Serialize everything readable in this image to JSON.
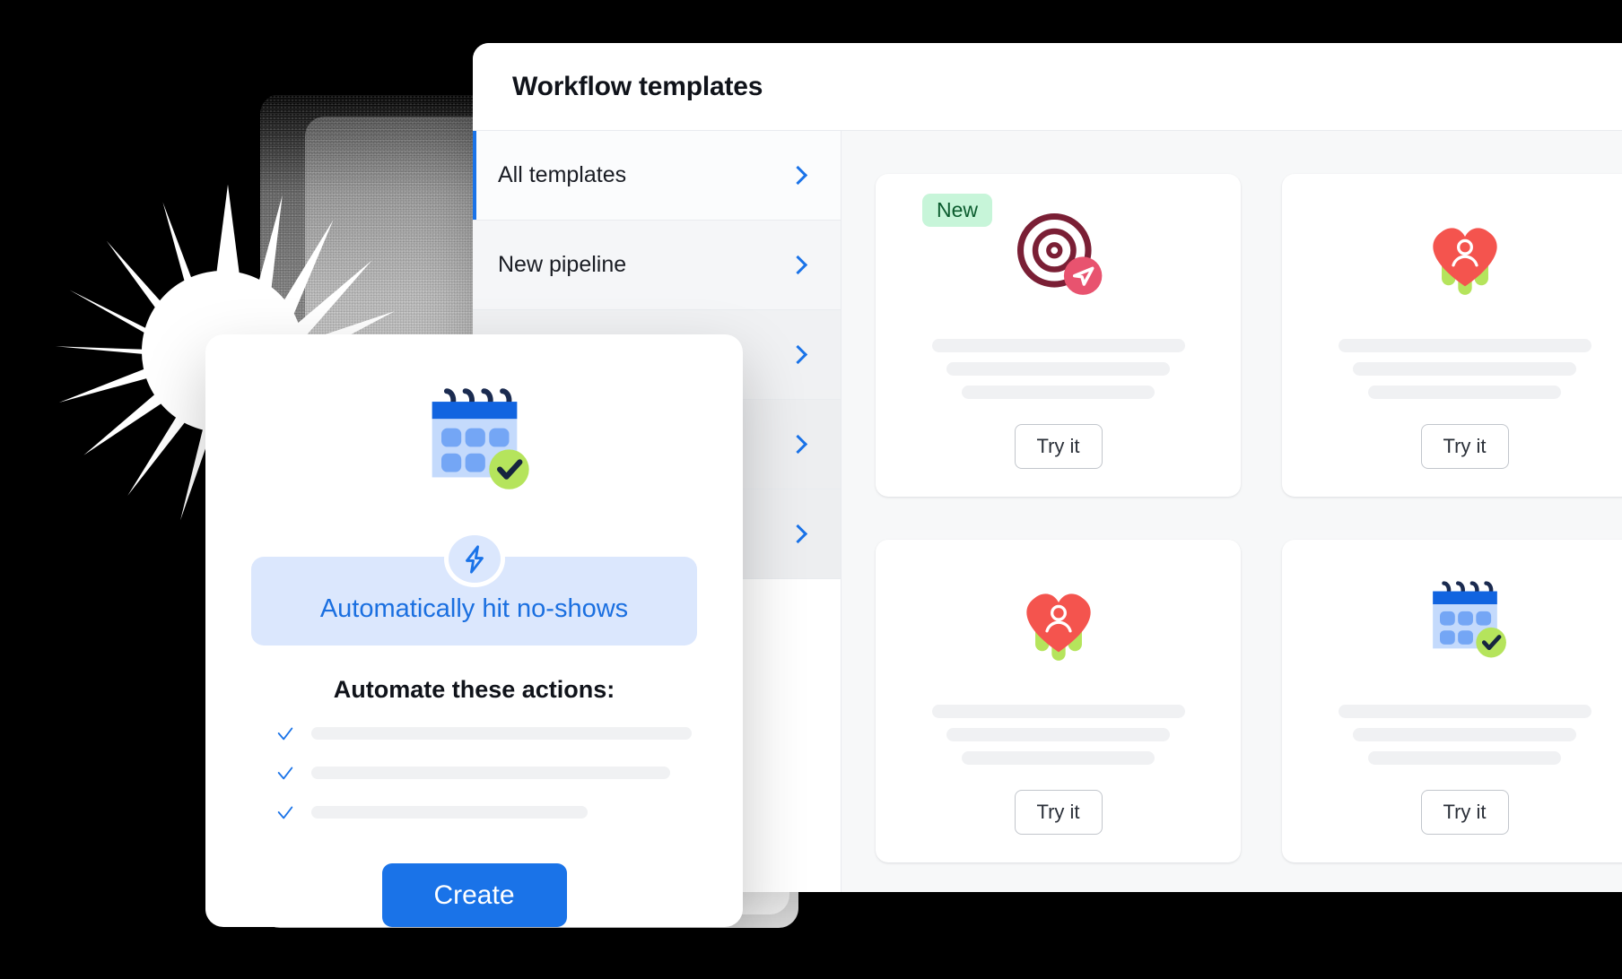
{
  "window": {
    "title": "Workflow templates"
  },
  "sidebar": {
    "items": [
      {
        "label": "All templates",
        "icon": "chevron-right-icon",
        "active": true
      },
      {
        "label": "New pipeline",
        "icon": "chevron-right-icon",
        "active": false
      },
      {
        "label": "",
        "icon": "chevron-right-icon",
        "active": false
      },
      {
        "label": "",
        "icon": "chevron-right-icon",
        "active": false
      },
      {
        "label": "",
        "icon": "chevron-right-icon",
        "active": false
      }
    ]
  },
  "templates": {
    "cards": [
      {
        "badge": "New",
        "icon": "target-send-icon",
        "cta": "Try it",
        "skeleton_lines": 3
      },
      {
        "badge": "",
        "icon": "heart-person-icon",
        "cta": "Try it",
        "skeleton_lines": 3
      },
      {
        "badge": "",
        "icon": "heart-person-icon",
        "cta": "Try it",
        "skeleton_lines": 3
      },
      {
        "badge": "",
        "icon": "calendar-check-icon",
        "cta": "Try it",
        "skeleton_lines": 3
      }
    ]
  },
  "popup": {
    "illustration_icon": "calendar-check-icon",
    "accent_icon": "lightning-bolt-icon",
    "pill_text": "Automatically hit no-shows",
    "section_heading": "Automate these actions:",
    "checklist": [
      {
        "icon": "check-icon",
        "text": ""
      },
      {
        "icon": "check-icon",
        "text": ""
      },
      {
        "icon": "check-icon",
        "text": ""
      }
    ],
    "primary_button": "Create"
  },
  "colors": {
    "accent_blue": "#1a73e8",
    "pill_bg": "#dbe7fd",
    "badge_bg": "#c7f5d9",
    "badge_text": "#0b5c2e",
    "heart_red": "#f4544e",
    "leaf_green": "#b5e45c",
    "target_maroon": "#7a1f35",
    "send_pink": "#e8536f",
    "check_green": "#b5e45c",
    "skeleton": "#f0f1f3",
    "canvas": "#f7f8f9",
    "background": "#000000"
  }
}
